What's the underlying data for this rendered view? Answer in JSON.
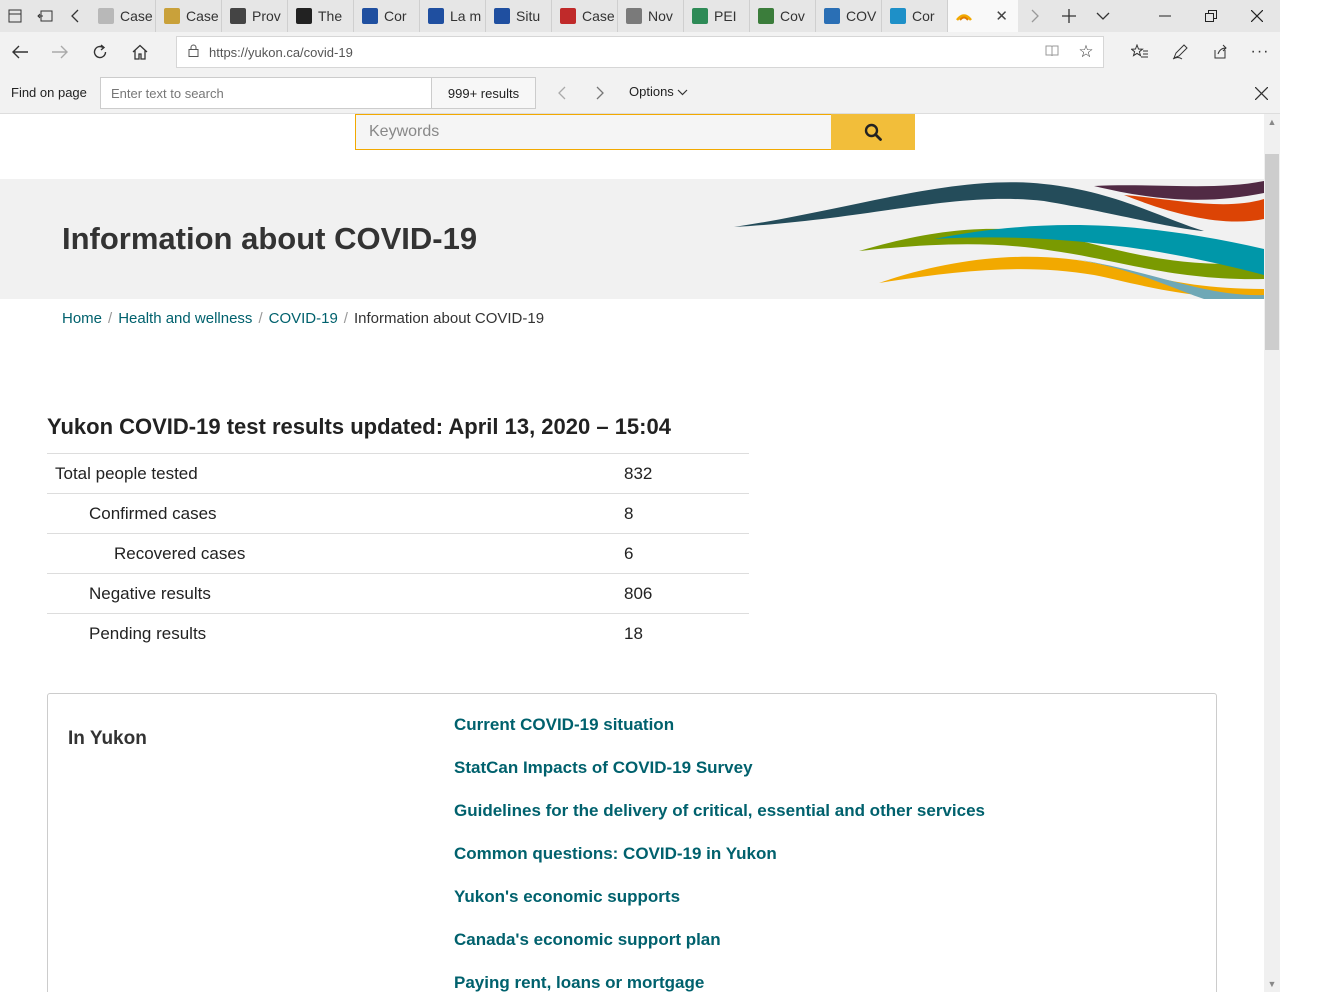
{
  "browser": {
    "tabs": [
      {
        "label": "Case",
        "color": "#b8b8b8"
      },
      {
        "label": "Case",
        "color": "#c9a13a"
      },
      {
        "label": "Prov",
        "color": "#444444"
      },
      {
        "label": "The",
        "color": "#222222"
      },
      {
        "label": "Cor",
        "color": "#1f4fa0"
      },
      {
        "label": "La m",
        "color": "#1f4fa0"
      },
      {
        "label": "Situ",
        "color": "#1f4fa0"
      },
      {
        "label": "Case",
        "color": "#c02a2a"
      },
      {
        "label": "Nov",
        "color": "#7a7a7a"
      },
      {
        "label": "PEI",
        "color": "#2e8b57"
      },
      {
        "label": "Cov",
        "color": "#3b7d3b"
      },
      {
        "label": "COV",
        "color": "#2a6fb5"
      },
      {
        "label": "Cor",
        "color": "#1e90c8"
      }
    ],
    "active_tab_color": "#f2a900",
    "url": "https://yukon.ca/covid-19"
  },
  "find": {
    "label": "Find on page",
    "placeholder": "Enter text to search",
    "count": "999+ results",
    "options_label": "Options"
  },
  "page": {
    "search_placeholder": "Keywords",
    "title": "Information about COVID-19",
    "breadcrumb": [
      "Home",
      "Health and wellness",
      "COVID-19",
      "Information about COVID-19"
    ],
    "results": {
      "title": "Yukon COVID-19 test results updated: April 13, 2020 – 15:04",
      "rows": [
        {
          "label": "Total people tested",
          "value": "832"
        },
        {
          "label": "Confirmed cases",
          "value": "8"
        },
        {
          "label": "Recovered cases",
          "value": "6"
        },
        {
          "label": "Negative results",
          "value": "806"
        },
        {
          "label": "Pending results",
          "value": "18"
        }
      ]
    },
    "in_yukon": {
      "heading": "In Yukon",
      "links": [
        "Current COVID-19 situation",
        "StatCan Impacts of COVID-19 Survey",
        "Guidelines for the delivery of critical, essential and other services",
        "Common questions: COVID-19 in Yukon",
        "Yukon's economic supports",
        "Canada's economic support plan",
        "Paying rent, loans or mortgage"
      ]
    },
    "colors": {
      "link": "#00616d",
      "search_accent": "#f2be3a"
    }
  }
}
